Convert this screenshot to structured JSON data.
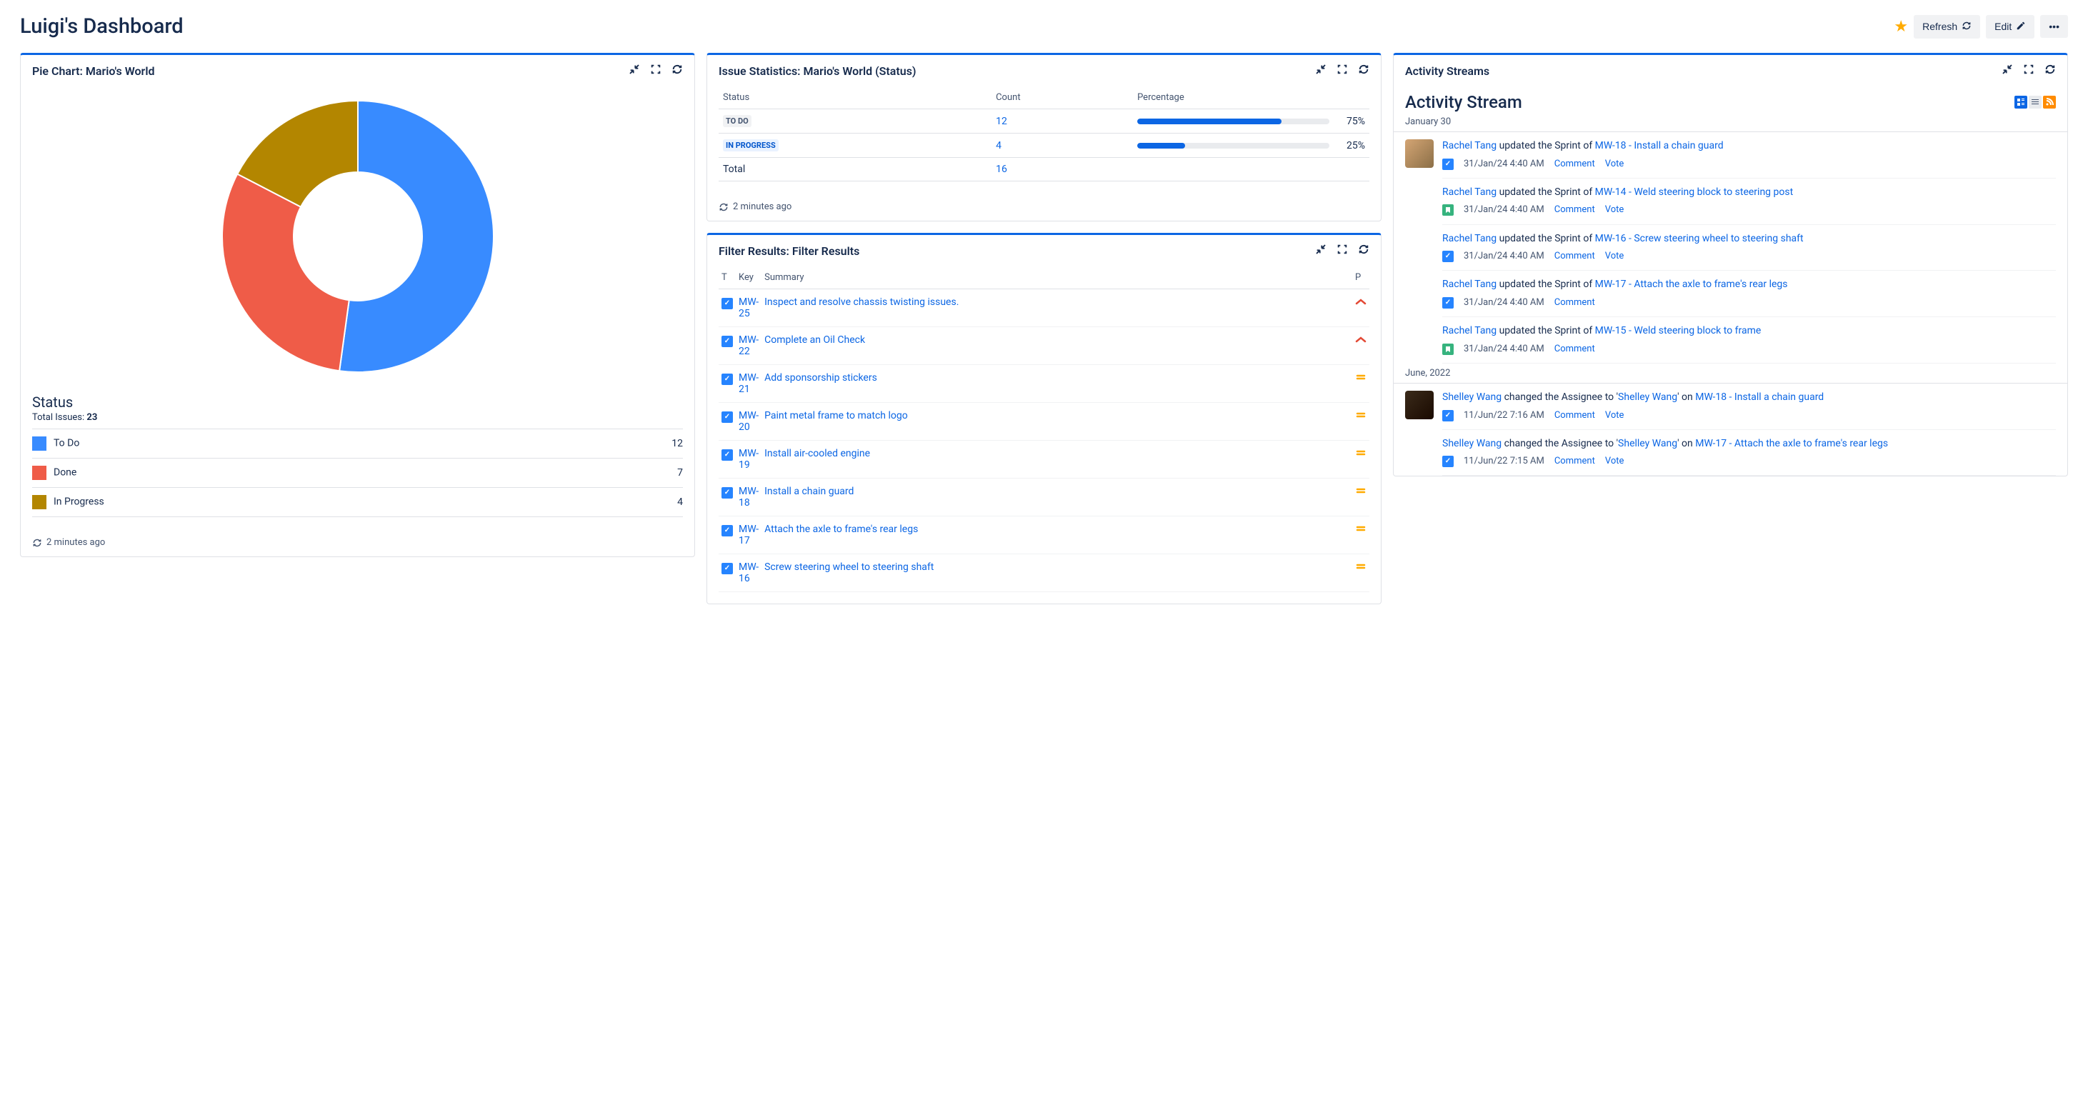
{
  "header": {
    "title": "Luigi's Dashboard",
    "refresh": "Refresh",
    "edit": "Edit"
  },
  "pie_gadget": {
    "title": "Pie Chart: Mario's World",
    "legend_title": "Status",
    "total_label": "Total Issues:",
    "total_value": "23",
    "legend": [
      {
        "label": "To Do",
        "value": "12",
        "color": "#388BFF"
      },
      {
        "label": "Done",
        "value": "7",
        "color": "#EF5C48"
      },
      {
        "label": "In Progress",
        "value": "4",
        "color": "#B38600"
      }
    ],
    "updated": "2 minutes ago"
  },
  "chart_data": {
    "type": "pie",
    "title": "Status",
    "series": [
      {
        "name": "To Do",
        "value": 12
      },
      {
        "name": "Done",
        "value": 7
      },
      {
        "name": "In Progress",
        "value": 4
      }
    ],
    "total": 23
  },
  "stats_gadget": {
    "title": "Issue Statistics: Mario's World (Status)",
    "cols": {
      "status": "Status",
      "count": "Count",
      "percentage": "Percentage"
    },
    "rows": [
      {
        "lozenge_class": "lozenge-todo",
        "status": "TO DO",
        "count": "12",
        "pct": "75%",
        "fill": 75
      },
      {
        "lozenge_class": "lozenge-inprogress",
        "status": "IN PROGRESS",
        "count": "4",
        "pct": "25%",
        "fill": 25
      }
    ],
    "total_label": "Total",
    "total_count": "16",
    "updated": "2 minutes ago"
  },
  "filter_gadget": {
    "title": "Filter Results: Filter Results",
    "cols": {
      "t": "T",
      "key": "Key",
      "summary": "Summary",
      "p": "P"
    },
    "rows": [
      {
        "key": "MW-25",
        "summary": "Inspect and resolve chassis twisting issues.",
        "priority": "high"
      },
      {
        "key": "MW-22",
        "summary": "Complete an Oil Check",
        "priority": "high"
      },
      {
        "key": "MW-21",
        "summary": "Add sponsorship stickers",
        "priority": "med"
      },
      {
        "key": "MW-20",
        "summary": "Paint metal frame to match logo",
        "priority": "med"
      },
      {
        "key": "MW-19",
        "summary": "Install air-cooled engine",
        "priority": "med"
      },
      {
        "key": "MW-18",
        "summary": "Install a chain guard",
        "priority": "med"
      },
      {
        "key": "MW-17",
        "summary": "Attach the axle to frame's rear legs",
        "priority": "med"
      },
      {
        "key": "MW-16",
        "summary": "Screw steering wheel to steering shaft",
        "priority": "med"
      }
    ]
  },
  "activity_gadget": {
    "title": "Activity Streams",
    "stream_title": "Activity Stream",
    "groups": [
      {
        "date": "January 30",
        "items": [
          {
            "avatar": "light",
            "user": "Rachel Tang",
            "action": " updated the Sprint of ",
            "issue": "MW-18 - Install a chain guard",
            "icon": "task",
            "time": "31/Jan/24 4:40 AM",
            "links": [
              "Comment",
              "Vote"
            ]
          },
          {
            "avatar": "",
            "user": "Rachel Tang",
            "action": " updated the Sprint of ",
            "issue": "MW-14 - Weld steering block to steering post",
            "icon": "story",
            "time": "31/Jan/24 4:40 AM",
            "links": [
              "Comment",
              "Vote"
            ]
          },
          {
            "avatar": "",
            "user": "Rachel Tang",
            "action": " updated the Sprint of ",
            "issue": "MW-16 - Screw steering wheel to steering shaft",
            "icon": "task",
            "time": "31/Jan/24 4:40 AM",
            "links": [
              "Comment",
              "Vote"
            ]
          },
          {
            "avatar": "",
            "user": "Rachel Tang",
            "action": " updated the Sprint of ",
            "issue": "MW-17 - Attach the axle to frame's rear legs",
            "icon": "task",
            "time": "31/Jan/24 4:40 AM",
            "links": [
              "Comment"
            ]
          },
          {
            "avatar": "",
            "user": "Rachel Tang",
            "action": " updated the Sprint of ",
            "issue": "MW-15 - Weld steering block to frame",
            "icon": "story",
            "time": "31/Jan/24 4:40 AM",
            "links": [
              "Comment"
            ]
          }
        ]
      },
      {
        "date": "June, 2022",
        "items": [
          {
            "avatar": "dark",
            "user": "Shelley Wang",
            "action": " changed the Assignee to '",
            "assignee": "Shelley Wang",
            "suffix": "' on ",
            "issue": "MW-18 - Install a chain guard",
            "icon": "task",
            "time": "11/Jun/22 7:16 AM",
            "links": [
              "Comment",
              "Vote"
            ]
          },
          {
            "avatar": "",
            "user": "Shelley Wang",
            "action": " changed the Assignee to '",
            "assignee": "Shelley Wang",
            "suffix": "' on ",
            "issue": "MW-17 - Attach the axle to frame's rear legs",
            "icon": "task",
            "time": "11/Jun/22 7:15 AM",
            "links": [
              "Comment",
              "Vote"
            ]
          }
        ]
      }
    ]
  }
}
